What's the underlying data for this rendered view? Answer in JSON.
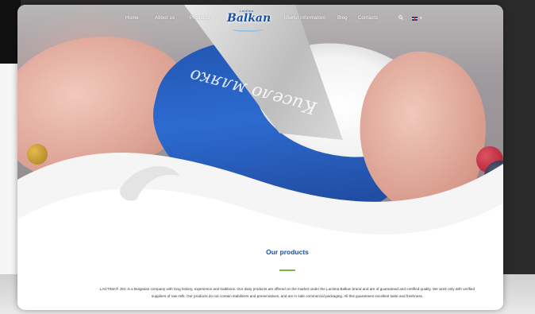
{
  "nav": {
    "items": [
      "Home",
      "About us",
      "Products",
      "Useful information",
      "Blog",
      "Contacts"
    ],
    "logo": {
      "brand": "Balkan",
      "top": "Lactima"
    },
    "language_icon": "flag-uk-icon",
    "search_icon": "search-icon",
    "chevron_icon": "chevron-down-icon"
  },
  "hero": {
    "cup_text": "Кисело мляко"
  },
  "products": {
    "title": "Our products",
    "description": "LACTIMA® JSC is a Bulgarian company with long history, experience and traditions. Our dairy products are offered on the market under the Lactima Balkan brand and are of guaranteed and certified quality. We work only with verified suppliers of raw milk. Our products do not contain stabilizers and preservatives, and are in safe commercial packaging. All this guarantees excellent taste and freshness."
  },
  "colors": {
    "brand_blue": "#1d4f9e",
    "accent_green": "#7ab648"
  }
}
